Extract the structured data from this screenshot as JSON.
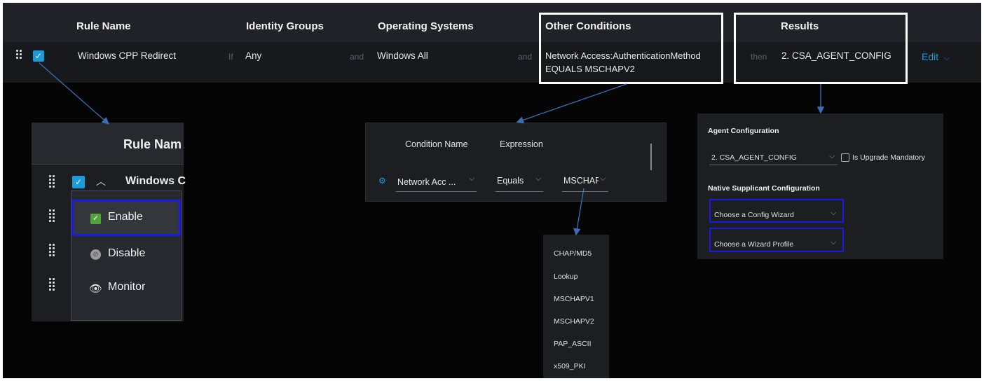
{
  "header": {
    "rule_name": "Rule Name",
    "identity_groups": "Identity Groups",
    "operating_systems": "Operating Systems",
    "other_conditions": "Other Conditions",
    "results": "Results"
  },
  "rule": {
    "name": "Windows CPP Redirect",
    "if_label": "If",
    "identity": "Any",
    "and_label": "and",
    "os": "Windows All",
    "condition_line1": "Network Access:AuthenticationMethod",
    "condition_line2": "EQUALS MSCHAPV2",
    "then_label": "then",
    "result": "2. CSA_AGENT_CONFIG",
    "edit_label": "Edit"
  },
  "status_zoom": {
    "header": "Rule Nam",
    "row_name": "Windows C",
    "menu": [
      "Enable",
      "Disable",
      "Monitor"
    ]
  },
  "condition_zoom": {
    "col_name": "Condition Name",
    "col_expression": "Expression",
    "name_value": "Network Acc ...",
    "operator_value": "Equals",
    "expression_value": "MSCHAF"
  },
  "auth_methods": [
    "CHAP/MD5",
    "Lookup",
    "MSCHAPV1",
    "MSCHAPV2",
    "PAP_ASCII",
    "x509_PKI"
  ],
  "results_zoom": {
    "agent_title": "Agent Configuration",
    "agent_value": "2. CSA_AGENT_CONFIG",
    "upgrade_label": "Is Upgrade Mandatory",
    "native_title": "Native Supplicant Configuration",
    "wizard_placeholder": "Choose a Config Wizard",
    "profile_placeholder": "Choose a Wizard Profile"
  },
  "colors": {
    "accent": "#1b9bd8",
    "highlight_border": "#ffffff",
    "focus_border": "#1a1ae6",
    "enable_green": "#52a43a",
    "arrow": "#3a6fb5"
  }
}
